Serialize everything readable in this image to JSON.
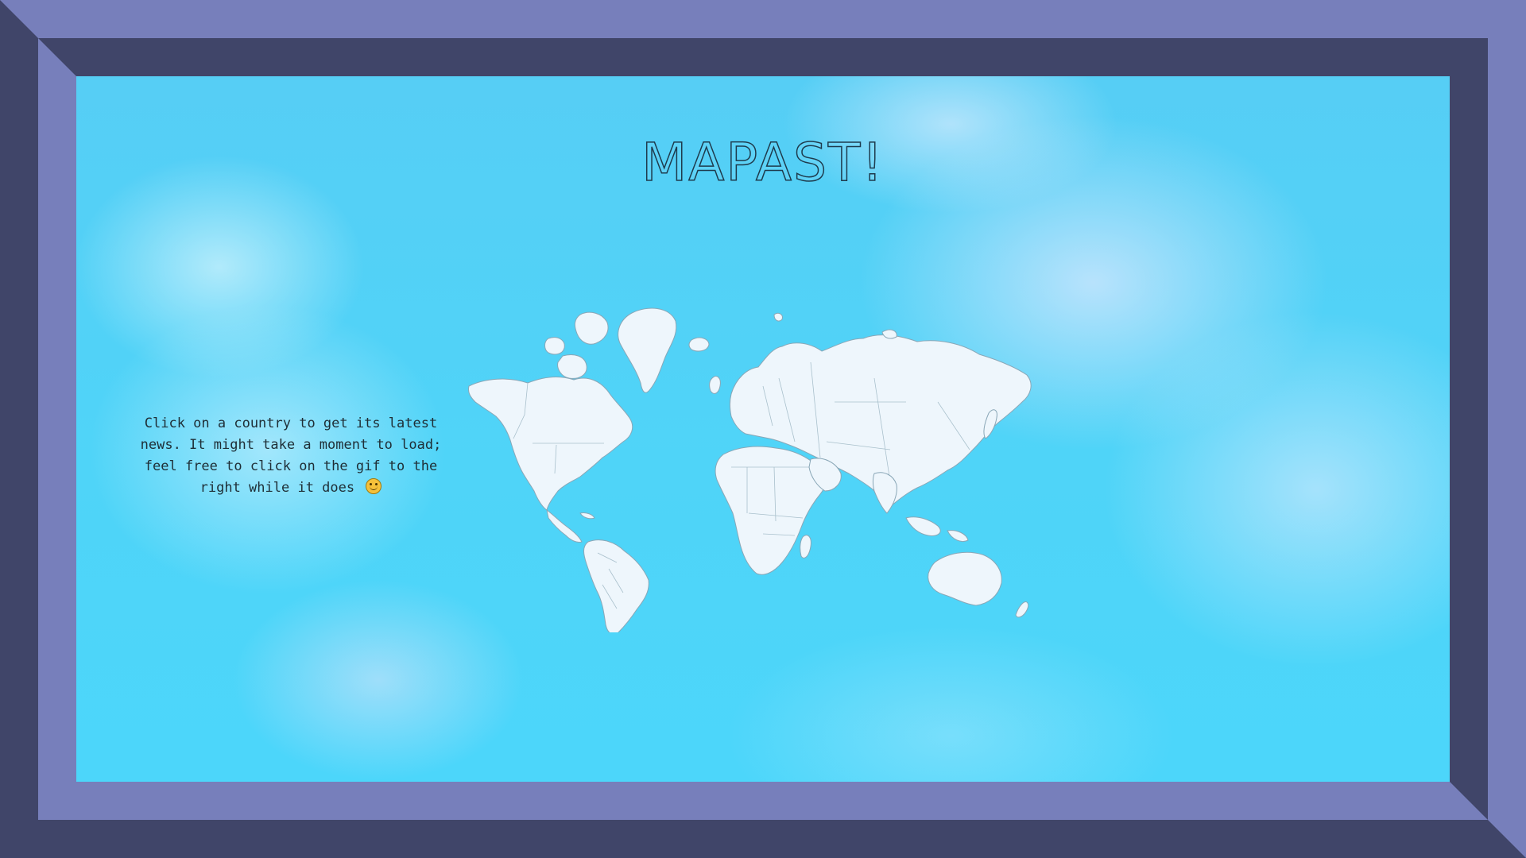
{
  "page": {
    "title": "MAPAST!",
    "hint_text": "Click on a country to get its latest news. It might take a moment to load; feel free to click on the gif to the right while it does"
  },
  "icons": {
    "smile": "slightly-smiling-face-icon"
  },
  "colors": {
    "frame_light": "#777fbb",
    "frame_dark": "#404569",
    "sky": "#4fd4f8",
    "land": "#eef6fc"
  }
}
